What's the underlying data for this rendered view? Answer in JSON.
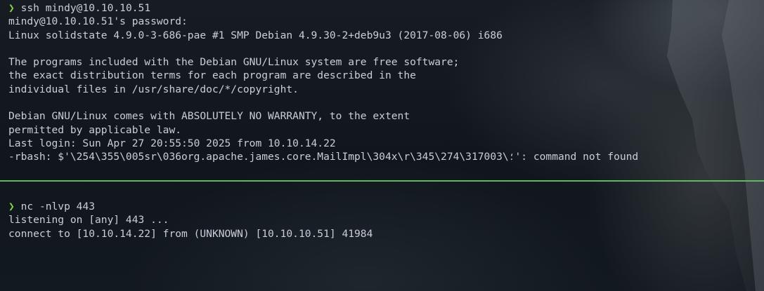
{
  "theme": {
    "text_color": "#c9ced8",
    "prompt_color": "#7fd64a",
    "divider_color": "#5fb95f",
    "background_color": "#10151b"
  },
  "top_pane": {
    "prompt_symbol": "❯",
    "command": "ssh mindy@10.10.10.51",
    "output": [
      "mindy@10.10.10.51's password:",
      "Linux solidstate 4.9.0-3-686-pae #1 SMP Debian 4.9.30-2+deb9u3 (2017-08-06) i686",
      "",
      "The programs included with the Debian GNU/Linux system are free software;",
      "the exact distribution terms for each program are described in the",
      "individual files in /usr/share/doc/*/copyright.",
      "",
      "Debian GNU/Linux comes with ABSOLUTELY NO WARRANTY, to the extent",
      "permitted by applicable law.",
      "Last login: Sun Apr 27 20:55:50 2025 from 10.10.14.22",
      "-rbash: $'\\254\\355\\005sr\\036org.apache.james.core.MailImpl\\304x\\r\\345\\274\\317؛\\003': command not found"
    ]
  },
  "bottom_pane": {
    "prompt_symbol": "❯",
    "command": "nc -nlvp 443",
    "output": [
      "listening on [any] 443 ...",
      "connect to [10.10.14.22] from (UNKNOWN) [10.10.10.51] 41984"
    ]
  }
}
